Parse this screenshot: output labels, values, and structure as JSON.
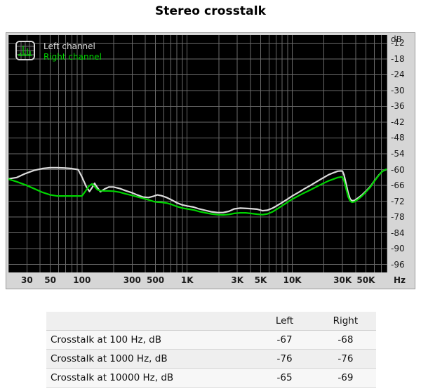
{
  "page_title": "Stereo crosstalk",
  "legend": {
    "icon": "spectrum-thumbnail-icon",
    "left_label": "Left channel",
    "right_label": "Right channel",
    "left_color": "#dcdcdc",
    "right_color": "#00d400"
  },
  "table": {
    "headers": [
      "",
      "Left",
      "Right"
    ],
    "rows": [
      {
        "label": "Crosstalk at 100 Hz, dB",
        "left": "-67",
        "right": "-68"
      },
      {
        "label": "Crosstalk at 1000 Hz, dB",
        "left": "-76",
        "right": "-76"
      },
      {
        "label": "Crosstalk at 10000 Hz, dB",
        "left": "-65",
        "right": "-69"
      }
    ]
  },
  "chart_data": {
    "type": "line",
    "title": "Stereo crosstalk",
    "xlabel": "Hz",
    "ylabel": "dB",
    "xscale": "log",
    "xlim": [
      20,
      80000
    ],
    "ylim": [
      -99,
      -9
    ],
    "grid": true,
    "legend_position": "top-left",
    "background": "#000000",
    "gridline_color": "#6a6a6a",
    "xticks": [
      {
        "value": 30,
        "label": "30"
      },
      {
        "value": 50,
        "label": "50"
      },
      {
        "value": 100,
        "label": "100"
      },
      {
        "value": 300,
        "label": "300"
      },
      {
        "value": 500,
        "label": "500"
      },
      {
        "value": 1000,
        "label": "1K"
      },
      {
        "value": 3000,
        "label": "3K"
      },
      {
        "value": 5000,
        "label": "5K"
      },
      {
        "value": 10000,
        "label": "10K"
      },
      {
        "value": 30000,
        "label": "30K"
      },
      {
        "value": 50000,
        "label": "50K"
      }
    ],
    "yticks": [
      -12,
      -18,
      -24,
      -30,
      -36,
      -42,
      -48,
      -54,
      -60,
      -66,
      -72,
      -78,
      -84,
      -90,
      -96
    ],
    "series": [
      {
        "name": "Left channel",
        "color": "#dcdcdc",
        "points": [
          [
            20,
            -63.5
          ],
          [
            24,
            -63.0
          ],
          [
            29,
            -61.5
          ],
          [
            35,
            -60.3
          ],
          [
            42,
            -59.6
          ],
          [
            50,
            -59.3
          ],
          [
            58,
            -59.3
          ],
          [
            68,
            -59.4
          ],
          [
            80,
            -59.6
          ],
          [
            92,
            -60.0
          ],
          [
            100,
            -62.8
          ],
          [
            110,
            -66.5
          ],
          [
            118,
            -68.3
          ],
          [
            125,
            -66.8
          ],
          [
            132,
            -65.2
          ],
          [
            140,
            -66.8
          ],
          [
            150,
            -68.4
          ],
          [
            165,
            -67.3
          ],
          [
            180,
            -66.6
          ],
          [
            200,
            -66.6
          ],
          [
            230,
            -67.2
          ],
          [
            260,
            -68.0
          ],
          [
            300,
            -68.8
          ],
          [
            340,
            -69.7
          ],
          [
            380,
            -70.4
          ],
          [
            430,
            -70.6
          ],
          [
            480,
            -70.1
          ],
          [
            520,
            -69.6
          ],
          [
            570,
            -69.9
          ],
          [
            640,
            -70.6
          ],
          [
            720,
            -71.6
          ],
          [
            800,
            -72.6
          ],
          [
            900,
            -73.4
          ],
          [
            1000,
            -73.8
          ],
          [
            1150,
            -74.2
          ],
          [
            1300,
            -74.9
          ],
          [
            1500,
            -75.5
          ],
          [
            1700,
            -76.0
          ],
          [
            1950,
            -76.3
          ],
          [
            2200,
            -76.3
          ],
          [
            2500,
            -75.8
          ],
          [
            2800,
            -74.9
          ],
          [
            3200,
            -74.6
          ],
          [
            3600,
            -74.7
          ],
          [
            4000,
            -74.8
          ],
          [
            4600,
            -75.0
          ],
          [
            5200,
            -75.6
          ],
          [
            5800,
            -75.4
          ],
          [
            6500,
            -74.6
          ],
          [
            7200,
            -73.6
          ],
          [
            8000,
            -72.5
          ],
          [
            9000,
            -71.2
          ],
          [
            10000,
            -70.0
          ],
          [
            11500,
            -68.6
          ],
          [
            13000,
            -67.3
          ],
          [
            15000,
            -65.9
          ],
          [
            17000,
            -64.6
          ],
          [
            19500,
            -63.2
          ],
          [
            22000,
            -62.0
          ],
          [
            25000,
            -61.1
          ],
          [
            27000,
            -60.6
          ],
          [
            29000,
            -60.5
          ],
          [
            30000,
            -60.6
          ],
          [
            31000,
            -62.0
          ],
          [
            32500,
            -65.5
          ],
          [
            34000,
            -69.0
          ],
          [
            35500,
            -71.2
          ],
          [
            37000,
            -71.8
          ],
          [
            39000,
            -71.7
          ],
          [
            42000,
            -70.8
          ],
          [
            46000,
            -69.6
          ],
          [
            50000,
            -68.2
          ],
          [
            55000,
            -66.5
          ],
          [
            60000,
            -64.4
          ],
          [
            66000,
            -62.2
          ],
          [
            72000,
            -60.6
          ],
          [
            78000,
            -60.0
          ]
        ]
      },
      {
        "name": "Right channel",
        "color": "#00d400",
        "points": [
          [
            20,
            -63.6
          ],
          [
            24,
            -64.6
          ],
          [
            29,
            -65.8
          ],
          [
            35,
            -67.2
          ],
          [
            42,
            -68.6
          ],
          [
            50,
            -69.6
          ],
          [
            58,
            -70.0
          ],
          [
            68,
            -70.0
          ],
          [
            80,
            -70.0
          ],
          [
            92,
            -70.0
          ],
          [
            100,
            -70.0
          ],
          [
            108,
            -68.2
          ],
          [
            116,
            -66.3
          ],
          [
            125,
            -65.4
          ],
          [
            132,
            -66.4
          ],
          [
            140,
            -67.6
          ],
          [
            150,
            -68.0
          ],
          [
            165,
            -68.1
          ],
          [
            180,
            -68.1
          ],
          [
            200,
            -68.2
          ],
          [
            230,
            -68.6
          ],
          [
            260,
            -69.2
          ],
          [
            300,
            -69.8
          ],
          [
            340,
            -70.4
          ],
          [
            380,
            -70.9
          ],
          [
            430,
            -71.5
          ],
          [
            480,
            -72.1
          ],
          [
            520,
            -72.3
          ],
          [
            570,
            -72.4
          ],
          [
            640,
            -72.7
          ],
          [
            720,
            -73.3
          ],
          [
            800,
            -74.0
          ],
          [
            900,
            -74.6
          ],
          [
            1000,
            -74.9
          ],
          [
            1150,
            -75.3
          ],
          [
            1300,
            -75.9
          ],
          [
            1500,
            -76.4
          ],
          [
            1700,
            -76.8
          ],
          [
            1950,
            -77.1
          ],
          [
            2200,
            -77.2
          ],
          [
            2500,
            -77.0
          ],
          [
            2800,
            -76.6
          ],
          [
            3200,
            -76.4
          ],
          [
            3600,
            -76.4
          ],
          [
            4000,
            -76.6
          ],
          [
            4600,
            -76.9
          ],
          [
            5200,
            -77.1
          ],
          [
            5800,
            -76.8
          ],
          [
            6500,
            -76.0
          ],
          [
            7200,
            -74.9
          ],
          [
            8000,
            -73.7
          ],
          [
            9000,
            -72.4
          ],
          [
            10000,
            -71.2
          ],
          [
            11500,
            -69.9
          ],
          [
            13000,
            -68.8
          ],
          [
            15000,
            -67.6
          ],
          [
            17000,
            -66.5
          ],
          [
            19500,
            -65.3
          ],
          [
            22000,
            -64.3
          ],
          [
            25000,
            -63.5
          ],
          [
            27000,
            -63.0
          ],
          [
            29000,
            -62.8
          ],
          [
            30000,
            -62.9
          ],
          [
            31000,
            -64.2
          ],
          [
            32500,
            -67.4
          ],
          [
            34000,
            -70.4
          ],
          [
            35500,
            -72.0
          ],
          [
            37000,
            -72.4
          ],
          [
            39000,
            -72.2
          ],
          [
            42000,
            -71.3
          ],
          [
            46000,
            -70.0
          ],
          [
            50000,
            -68.5
          ],
          [
            55000,
            -66.7
          ],
          [
            60000,
            -64.5
          ],
          [
            66000,
            -62.3
          ],
          [
            72000,
            -60.6
          ],
          [
            78000,
            -59.9
          ]
        ]
      }
    ]
  }
}
